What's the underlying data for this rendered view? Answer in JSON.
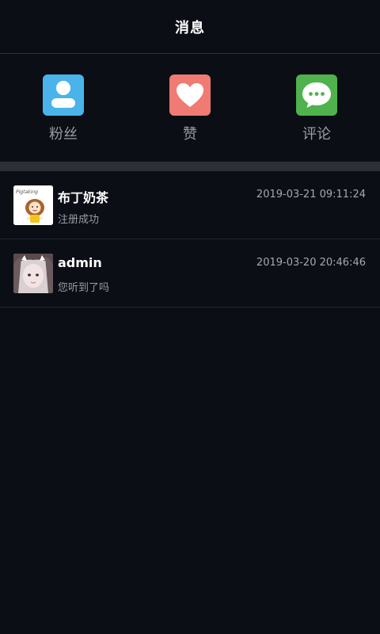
{
  "header": {
    "title": "消息"
  },
  "categories": [
    {
      "label": "粉丝",
      "icon": "person-icon",
      "color": "#4ab3ea"
    },
    {
      "label": "赞",
      "icon": "heart-icon",
      "color": "#ef7b73"
    },
    {
      "label": "评论",
      "icon": "chat-bubble-icon",
      "color": "#4fb24d"
    }
  ],
  "messages": [
    {
      "name": "布丁奶茶",
      "time": "2019-03-21 09:11:24",
      "preview": "注册成功",
      "avatar": "cartoon-girl-avatar",
      "avatar_text": "Pigtaking"
    },
    {
      "name": "admin",
      "time": "2019-03-20 20:46:46",
      "preview": "您听到了吗",
      "avatar": "selfie-girl-avatar"
    }
  ],
  "colors": {
    "background": "#0c0e15",
    "divider": "#2e3038",
    "secondary_text": "#9b9da3"
  }
}
